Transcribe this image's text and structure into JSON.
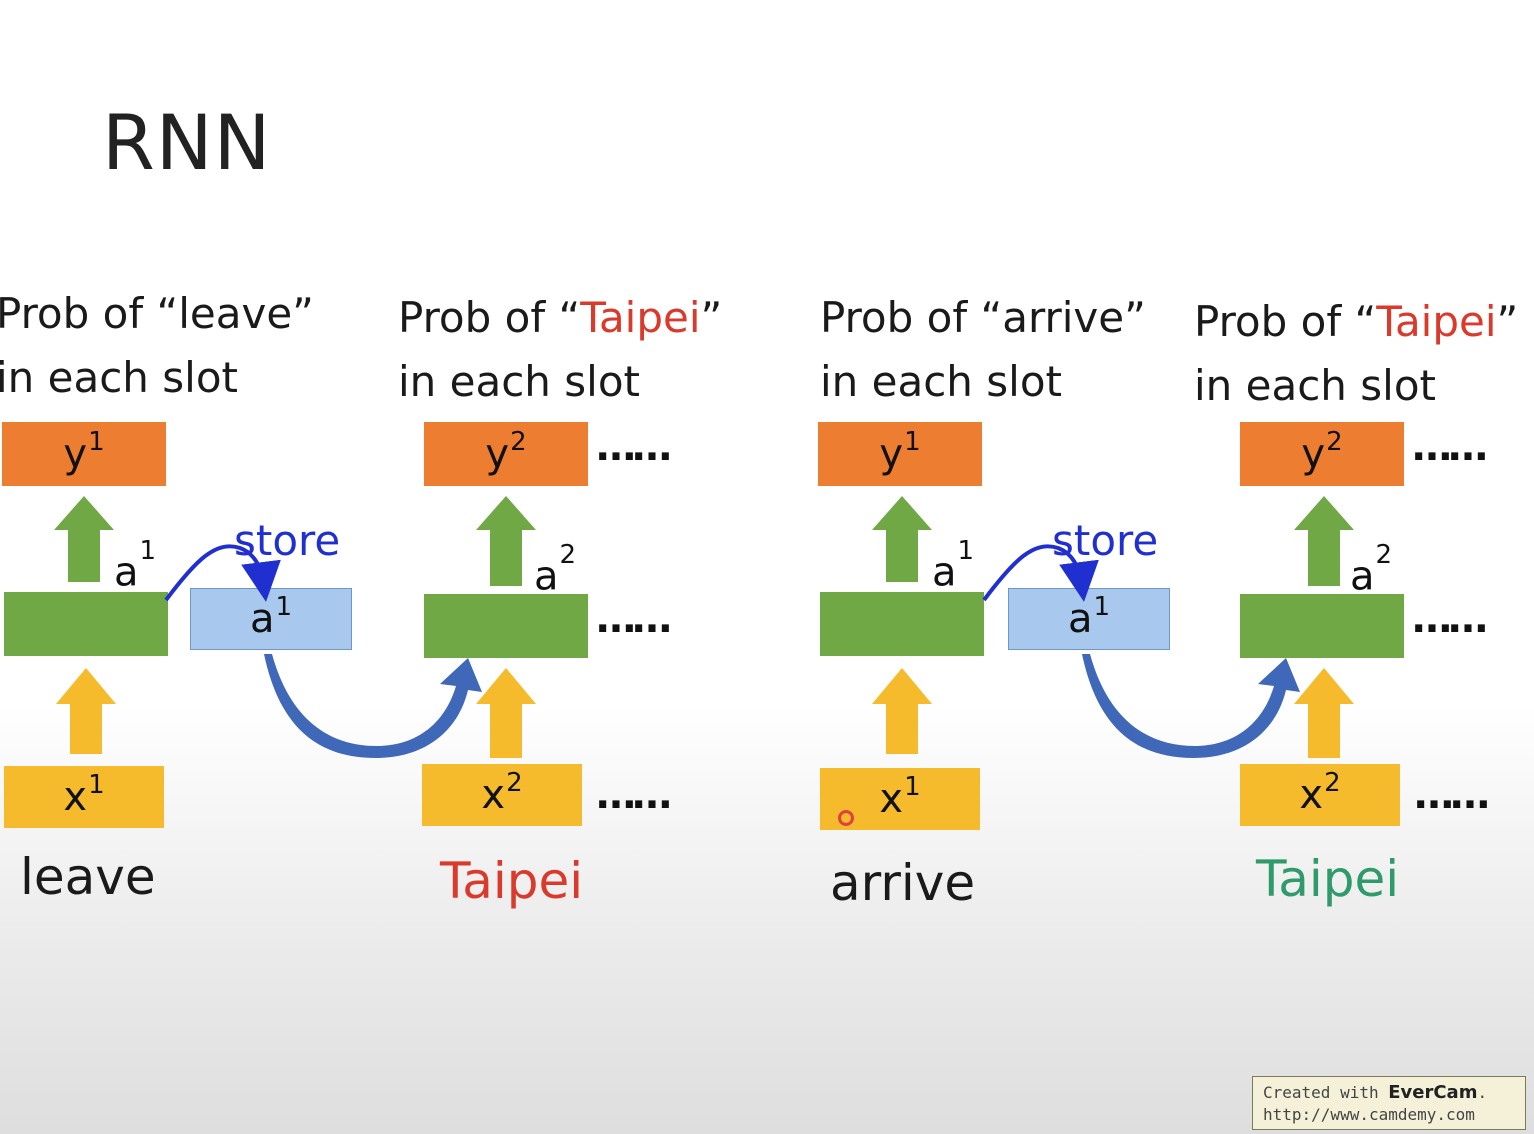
{
  "slide": {
    "title": "RNN",
    "left": {
      "caption1": {
        "line1_prefix": "Prob of “leave”",
        "line2": "in each slot"
      },
      "caption2": {
        "line1_prefix": "Prob of “",
        "line1_highlight": "Taipei",
        "line1_suffix": "”",
        "line2": "in each slot"
      },
      "y1": {
        "base": "y",
        "sup": "1"
      },
      "y2": {
        "base": "y",
        "sup": "2"
      },
      "a1_label": {
        "base": "a",
        "sup": "1"
      },
      "a2_label": {
        "base": "a",
        "sup": "2"
      },
      "store_label": "store",
      "store_box": {
        "base": "a",
        "sup": "1"
      },
      "x1": {
        "base": "x",
        "sup": "1"
      },
      "x2": {
        "base": "x",
        "sup": "2"
      },
      "word1": "leave",
      "word2": "Taipei",
      "ellipsis": "……"
    },
    "right": {
      "caption1": {
        "line1_prefix": "Prob of “arrive”",
        "line2": "in each slot"
      },
      "caption2": {
        "line1_prefix": "Prob of “",
        "line1_highlight": "Taipei",
        "line1_suffix": "”",
        "line2": "in each slot"
      },
      "y1": {
        "base": "y",
        "sup": "1"
      },
      "y2": {
        "base": "y",
        "sup": "2"
      },
      "a1_label": {
        "base": "a",
        "sup": "1"
      },
      "a2_label": {
        "base": "a",
        "sup": "2"
      },
      "store_label": "store",
      "store_box": {
        "base": "a",
        "sup": "1"
      },
      "x1": {
        "base": "x",
        "sup": "1"
      },
      "x2": {
        "base": "x",
        "sup": "2"
      },
      "word1": "arrive",
      "word2": "Taipei",
      "ellipsis": "……"
    }
  },
  "colors": {
    "output": "#ed7d31",
    "hidden": "#70a846",
    "input": "#f5bb2c",
    "memory": "#a8c8ee",
    "store_arrow": "#2030d0",
    "recurrent_arrow": "#3f68b8",
    "highlight_red": "#d93a2b",
    "highlight_teal": "#2f9a6a"
  },
  "watermark": {
    "line1_prefix": "Created with ",
    "brand": "EverCam",
    "line1_suffix": ".",
    "line2": "http://www.camdemy.com"
  }
}
